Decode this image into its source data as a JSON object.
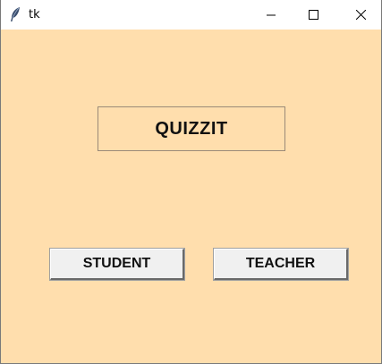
{
  "window": {
    "title": "tk",
    "controls": {
      "minimize_icon": "minimize-icon",
      "maximize_icon": "maximize-icon",
      "close_icon": "close-icon"
    }
  },
  "colors": {
    "background": "#ffdead",
    "button_face": "#f0f0f0"
  },
  "main": {
    "heading": "QUIZZIT",
    "buttons": {
      "student": "STUDENT",
      "teacher": "TEACHER"
    }
  }
}
